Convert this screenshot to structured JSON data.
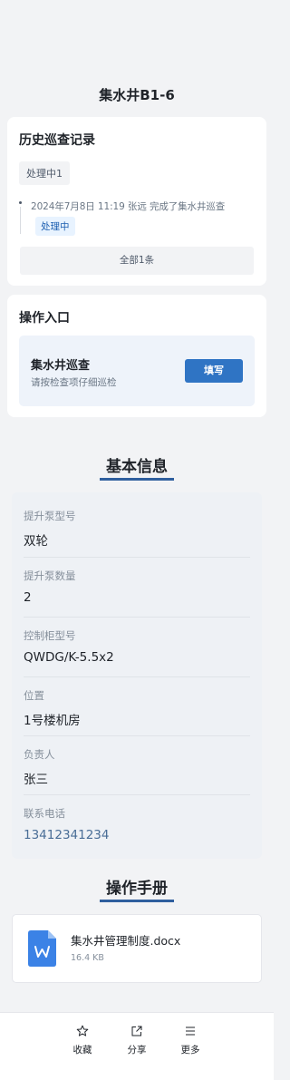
{
  "page": {
    "title": "集水井B1-6"
  },
  "history": {
    "title": "历史巡查记录",
    "filter_chip": "处理中1",
    "records": [
      {
        "text": "2024年7月8日 11:19  张远  完成了集水井巡查",
        "status": "处理中"
      }
    ],
    "view_all": "全部1条"
  },
  "entry": {
    "title": "操作入口",
    "item_name": "集水井巡查",
    "item_desc": "请按检查项仔细巡检",
    "button_label": "填写"
  },
  "basic_info": {
    "heading": "基本信息",
    "fields": [
      {
        "label": "提升泵型号",
        "value": "双轮"
      },
      {
        "label": "提升泵数量",
        "value": "2"
      },
      {
        "label": "控制柜型号",
        "value": "QWDG/K-5.5x2"
      },
      {
        "label": "位置",
        "value": "1号楼机房"
      },
      {
        "label": "负责人",
        "value": "张三"
      },
      {
        "label": "联系电话",
        "value": "13412341234"
      }
    ]
  },
  "manual": {
    "heading": "操作手册",
    "file": {
      "name": "集水井管理制度.docx",
      "size": "16.4 KB",
      "icon": "word-doc-icon"
    }
  },
  "bottom_bar": {
    "items": [
      {
        "label": "收藏",
        "icon": "star-icon"
      },
      {
        "label": "分享",
        "icon": "share-icon"
      },
      {
        "label": "更多",
        "icon": "menu-icon"
      }
    ]
  },
  "colors": {
    "accent": "#2f74c4",
    "underline": "#2f5f9e",
    "background": "#f2f3f5",
    "badge_bg": "#e8f3ff",
    "word_icon": "#3b82e6"
  }
}
